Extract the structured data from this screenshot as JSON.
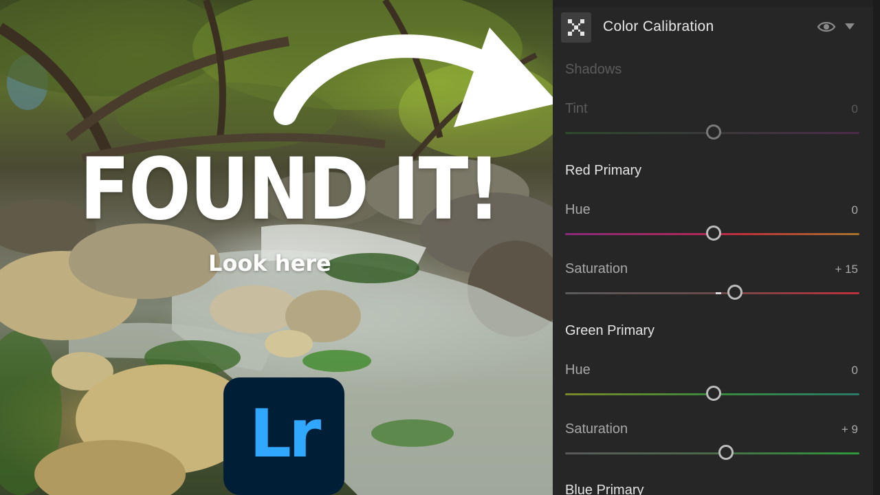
{
  "thumbnail": {
    "headline": "FOUND IT!",
    "subline": "Look here",
    "logo_text": "Lr"
  },
  "panel": {
    "title": "Color Calibration",
    "sections": {
      "shadows": {
        "label": "Shadows",
        "tint": {
          "label": "Tint",
          "value": "0",
          "position": 0.5
        }
      },
      "red_primary": {
        "label": "Red Primary",
        "hue": {
          "label": "Hue",
          "value": "0",
          "position": 0.5
        },
        "saturation": {
          "label": "Saturation",
          "value": "+ 15",
          "position": 0.575
        }
      },
      "green_primary": {
        "label": "Green Primary",
        "hue": {
          "label": "Hue",
          "value": "0",
          "position": 0.5
        },
        "saturation": {
          "label": "Saturation",
          "value": "+ 9",
          "position": 0.545
        }
      },
      "blue_primary": {
        "label": "Blue Primary"
      }
    }
  },
  "colors": {
    "panel_bg": "#262626",
    "lr_logo_bg": "#001e36",
    "lr_logo_fg": "#31a8ff",
    "thumb_border": "#bdbdbd"
  },
  "icons": {
    "panel_icon": "color-calibration-grid-icon",
    "visibility": "eye-icon",
    "collapse": "chevron-down-icon",
    "arrow": "curved-arrow-icon"
  }
}
